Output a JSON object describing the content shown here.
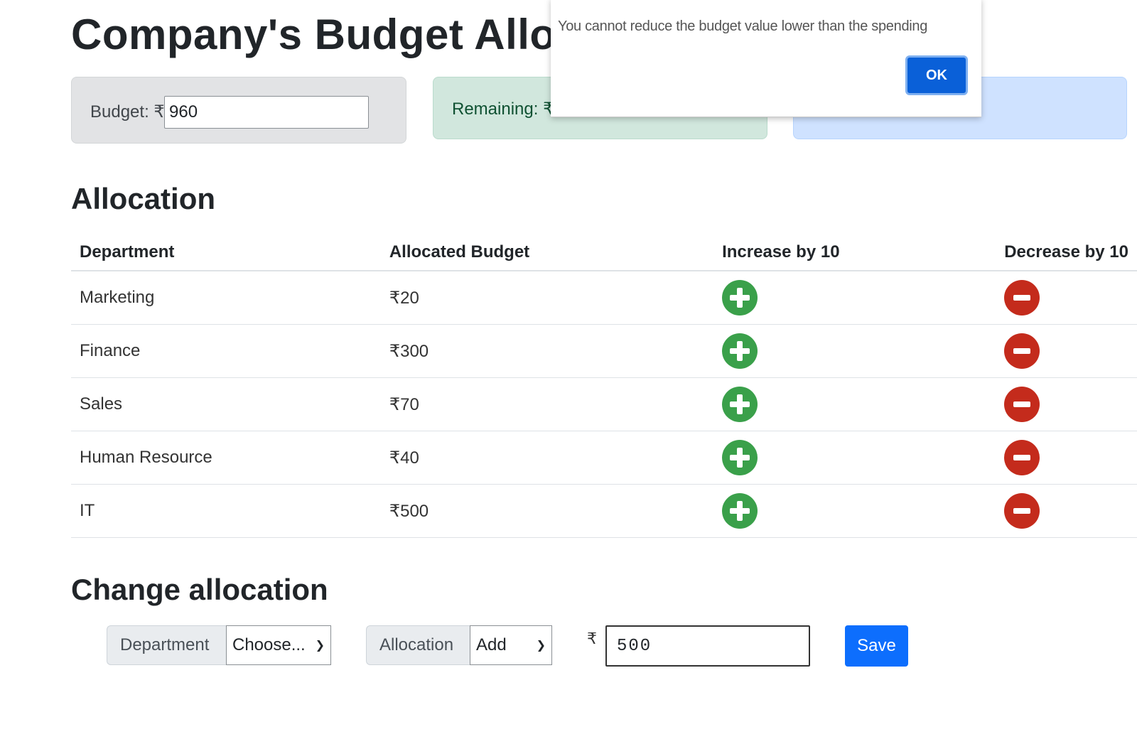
{
  "header": {
    "title": "Company's Budget Allocation"
  },
  "cards": {
    "budget_label": "Budget: ₹",
    "budget_value": "960",
    "remaining_label": "Remaining: ₹"
  },
  "allocation": {
    "title": "Allocation",
    "columns": [
      "Department",
      "Allocated Budget",
      "Increase by 10",
      "Decrease by 10"
    ],
    "rows": [
      {
        "department": "Marketing",
        "budget": "₹20"
      },
      {
        "department": "Finance",
        "budget": "₹300"
      },
      {
        "department": "Sales",
        "budget": "₹70"
      },
      {
        "department": "Human Resource",
        "budget": "₹40"
      },
      {
        "department": "IT",
        "budget": "₹500"
      }
    ]
  },
  "change": {
    "title": "Change allocation",
    "department_label": "Department",
    "department_selected": "Choose...",
    "allocation_label": "Allocation",
    "allocation_selected": "Add",
    "currency": "₹",
    "amount_value": "500",
    "save_label": "Save"
  },
  "alert": {
    "message": "You cannot reduce the budget value lower than the spending",
    "ok_label": "OK"
  },
  "colors": {
    "increase": "#3aa04a",
    "decrease": "#c42b1c",
    "primary": "#0d6efd"
  }
}
